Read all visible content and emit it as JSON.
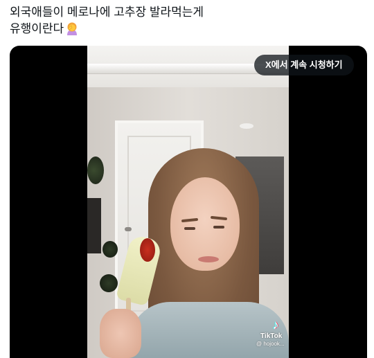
{
  "tweet": {
    "line1": "외국애들이 메로나에 고추장 발라먹는게",
    "line2": "유행이란다",
    "emoji": "woman-facepalming-emoji"
  },
  "media": {
    "watch_on_x_label": "X에서 계속 시청하기",
    "watermark": {
      "brand": "TikTok",
      "handle": "@ hojook..."
    }
  },
  "colors": {
    "text": "#0f1419",
    "pill_bg": "#0f1419",
    "video_letterbox": "#000000"
  }
}
